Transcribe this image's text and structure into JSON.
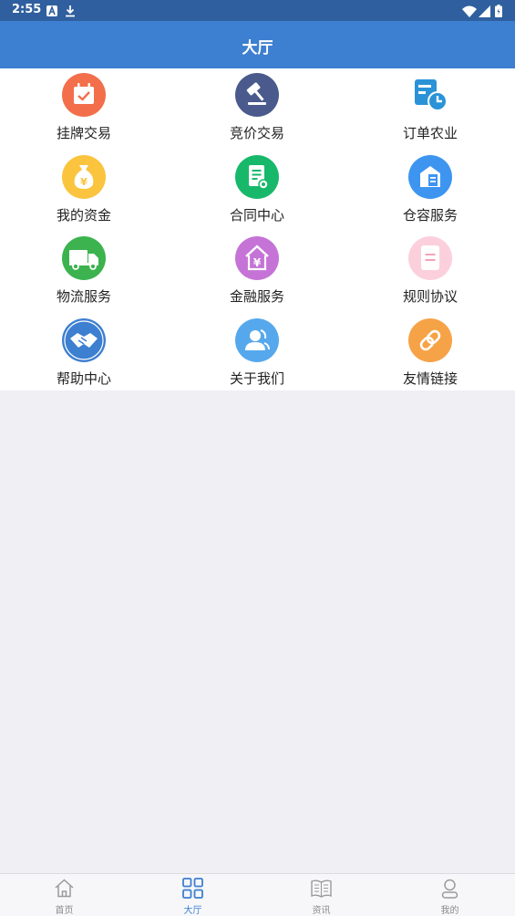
{
  "status_bar": {
    "time": "2:55"
  },
  "header": {
    "title": "大厅"
  },
  "menu": [
    {
      "label": "挂牌交易",
      "icon": "calendar-icon",
      "color": "#f36e4b"
    },
    {
      "label": "竞价交易",
      "icon": "gavel-icon",
      "color": "#4a5a8c"
    },
    {
      "label": "订单农业",
      "icon": "order-clock-icon",
      "color": "#ffffff"
    },
    {
      "label": "我的资金",
      "icon": "money-bag-icon",
      "color": "#fbc43e"
    },
    {
      "label": "合同中心",
      "icon": "contract-icon",
      "color": "#18b86b"
    },
    {
      "label": "仓容服务",
      "icon": "warehouse-icon",
      "color": "#3d95f0"
    },
    {
      "label": "物流服务",
      "icon": "truck-icon",
      "color": "#3cb34f"
    },
    {
      "label": "金融服务",
      "icon": "finance-house-icon",
      "color": "#c573d6"
    },
    {
      "label": "规则协议",
      "icon": "rules-document-icon",
      "color": "#fbd0dc"
    },
    {
      "label": "帮助中心",
      "icon": "handshake-icon",
      "color": "#3d7fd0"
    },
    {
      "label": "关于我们",
      "icon": "contacts-icon",
      "color": "#56a8ec"
    },
    {
      "label": "友情链接",
      "icon": "link-icon",
      "color": "#f6a348"
    }
  ],
  "tabs": [
    {
      "label": "首页",
      "icon": "home-icon",
      "active": false
    },
    {
      "label": "大厅",
      "icon": "grid-icon",
      "active": true
    },
    {
      "label": "资讯",
      "icon": "news-icon",
      "active": false
    },
    {
      "label": "我的",
      "icon": "user-icon",
      "active": false
    }
  ],
  "colors": {
    "primary": "#3d7fd0",
    "status_bar": "#2f5f9e",
    "background": "#efeff4"
  }
}
